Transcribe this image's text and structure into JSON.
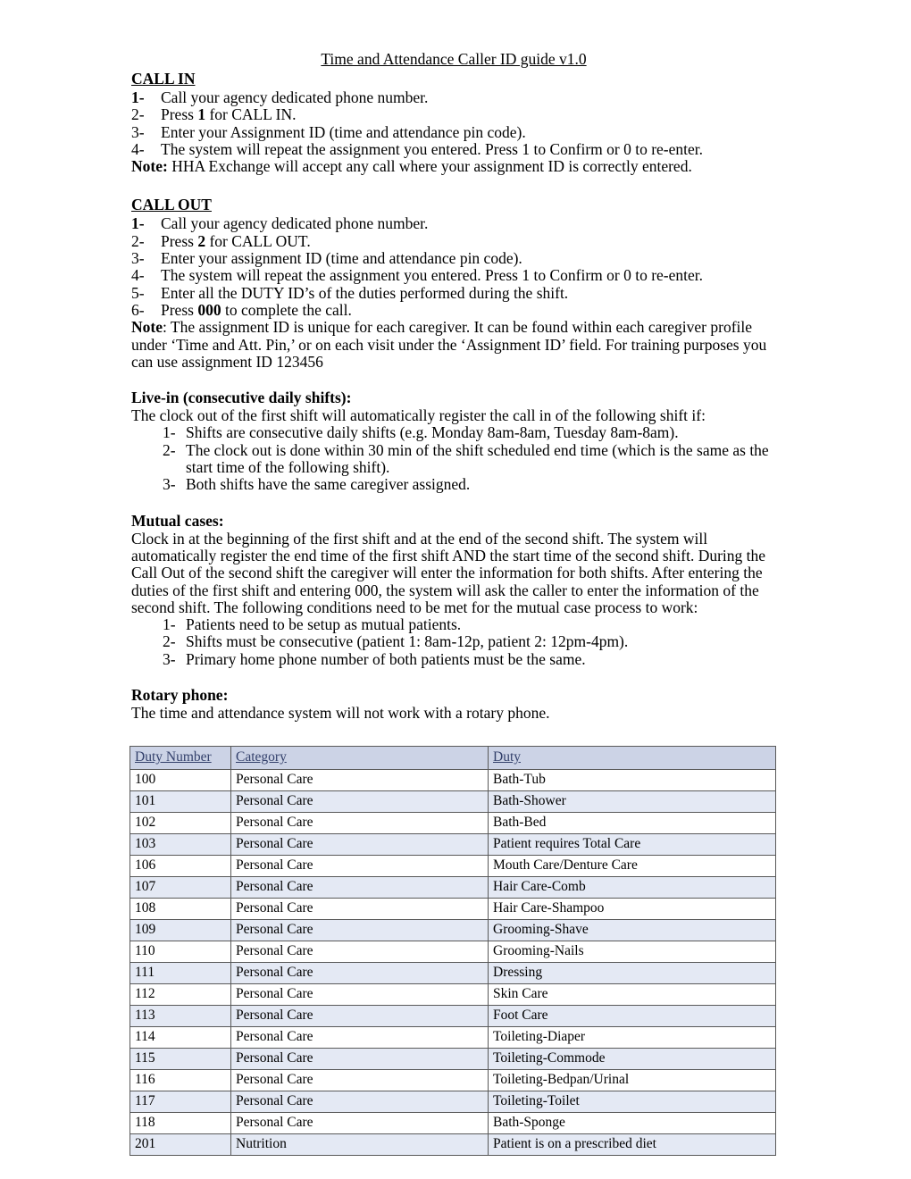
{
  "document": {
    "title": "Time and Attendance Caller ID guide v1.0"
  },
  "sections": {
    "call_in": {
      "heading": "CALL IN",
      "steps": [
        {
          "num": "1-",
          "bold_num": true,
          "text_before": "Call your agency dedicated phone number.",
          "bold": "",
          "text_after": ""
        },
        {
          "num": "2-",
          "bold_num": false,
          "text_before": "Press ",
          "bold": "1",
          "text_after": " for CALL IN."
        },
        {
          "num": "3-",
          "bold_num": false,
          "text_before": "Enter your Assignment ID (time and attendance pin code).",
          "bold": "",
          "text_after": ""
        },
        {
          "num": "4-",
          "bold_num": false,
          "text_before": "The system will repeat the assignment you entered. Press 1 to Confirm or 0 to re-enter.",
          "bold": "",
          "text_after": ""
        }
      ],
      "note_label": "Note:",
      "note_text": " HHA Exchange will accept any call where your assignment ID is correctly entered."
    },
    "call_out": {
      "heading": "CALL OUT",
      "steps": [
        {
          "num": "1-",
          "bold_num": true,
          "text_before": "Call your agency dedicated phone number.",
          "bold": "",
          "text_after": ""
        },
        {
          "num": "2-",
          "bold_num": false,
          "text_before": "Press ",
          "bold": "2",
          "text_after": " for CALL OUT."
        },
        {
          "num": "3-",
          "bold_num": false,
          "text_before": "Enter your assignment ID (time and attendance pin code).",
          "bold": "",
          "text_after": ""
        },
        {
          "num": "4-",
          "bold_num": false,
          "text_before": "The system will repeat the assignment you entered. Press 1 to Confirm or 0 to re-enter.",
          "bold": "",
          "text_after": ""
        },
        {
          "num": "5-",
          "bold_num": false,
          "text_before": "Enter all the DUTY ID’s of the duties performed during the shift.",
          "bold": "",
          "text_after": ""
        },
        {
          "num": "6-",
          "bold_num": false,
          "text_before": "Press ",
          "bold": "000",
          "text_after": " to complete the call."
        }
      ],
      "note_label": "Note",
      "note_text": ": The assignment ID is unique for each caregiver. It can be found within each caregiver profile under ‘Time and Att. Pin,’ or on each visit under the ‘Assignment ID’ field. For training purposes you can use assignment ID 123456"
    },
    "live_in": {
      "heading": "Live-in (consecutive daily shifts):",
      "intro": "The clock out of the first shift will automatically register the call in of the following shift if:",
      "items": [
        {
          "num": "1-",
          "text": "Shifts are consecutive daily shifts (e.g. Monday 8am-8am, Tuesday 8am-8am)."
        },
        {
          "num": "2-",
          "text": "The clock out is done within 30 min of the shift scheduled end time (which is the same as the start time of the following shift)."
        },
        {
          "num": "3-",
          "text": "Both shifts have the same caregiver assigned."
        }
      ]
    },
    "mutual_cases": {
      "heading": "Mutual cases:",
      "intro": "Clock in at the beginning of the first shift and at the end of the second shift. The system will automatically register the end time of the first shift AND the start time of the second shift. During the Call Out of the second shift the caregiver will enter the information for both shifts. After entering the duties of the first shift and entering 000, the system will ask the caller to enter the information of the second shift. The following conditions need to be met for the mutual case process to work:",
      "items": [
        {
          "num": "1-",
          "text": "Patients need to be setup as mutual patients."
        },
        {
          "num": "2-",
          "text": "Shifts must be consecutive (patient 1: 8am-12p, patient 2: 12pm-4pm)."
        },
        {
          "num": "3-",
          "text": "Primary home phone number of both patients must be the same."
        }
      ]
    },
    "rotary_phone": {
      "heading": "Rotary phone:",
      "text": "The time and attendance system will not work with a rotary phone."
    }
  },
  "duty_table": {
    "columns": [
      "Duty Number",
      "Category",
      "Duty"
    ],
    "rows": [
      [
        "100",
        "Personal Care",
        "Bath-Tub"
      ],
      [
        "101",
        "Personal Care",
        "Bath-Shower"
      ],
      [
        "102",
        "Personal Care",
        "Bath-Bed"
      ],
      [
        "103",
        "Personal Care",
        "Patient requires Total Care"
      ],
      [
        "106",
        "Personal Care",
        "Mouth Care/Denture Care"
      ],
      [
        "107",
        "Personal Care",
        "Hair Care-Comb"
      ],
      [
        "108",
        "Personal Care",
        "Hair Care-Shampoo"
      ],
      [
        "109",
        "Personal Care",
        "Grooming-Shave"
      ],
      [
        "110",
        "Personal Care",
        "Grooming-Nails"
      ],
      [
        "111",
        "Personal Care",
        "Dressing"
      ],
      [
        "112",
        "Personal Care",
        "Skin Care"
      ],
      [
        "113",
        "Personal Care",
        "Foot Care"
      ],
      [
        "114",
        "Personal Care",
        "Toileting-Diaper"
      ],
      [
        "115",
        "Personal Care",
        "Toileting-Commode"
      ],
      [
        "116",
        "Personal Care",
        "Toileting-Bedpan/Urinal"
      ],
      [
        "117",
        "Personal Care",
        "Toileting-Toilet"
      ],
      [
        "118",
        "Personal Care",
        "Bath-Sponge"
      ],
      [
        "201",
        "Nutrition",
        "Patient is on a prescribed diet"
      ]
    ]
  },
  "colors": {
    "header_fill": "#ccd3e6",
    "header_text": "#33406b",
    "row_alt_fill": "#e4e9f4",
    "row_fill": "#ffffff",
    "border": "#595959",
    "text": "#000000"
  }
}
